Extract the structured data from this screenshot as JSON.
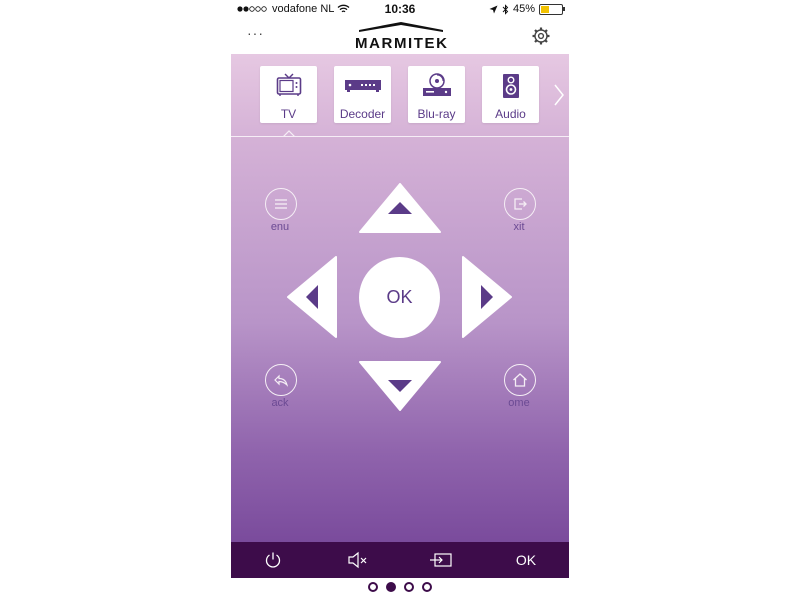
{
  "status_bar": {
    "carrier": "vodafone NL",
    "time": "10:36",
    "battery_percent_text": "45%",
    "battery_level": 0.45
  },
  "header": {
    "logo_text": "MARMITEK",
    "more_label": "···"
  },
  "devices": [
    {
      "label": "TV",
      "icon": "tv-icon",
      "selected": true
    },
    {
      "label": "Decoder",
      "icon": "decoder-icon",
      "selected": false
    },
    {
      "label": "Blu-ray",
      "icon": "bluray-icon",
      "selected": false
    },
    {
      "label": "Audio",
      "icon": "speaker-icon",
      "selected": false
    }
  ],
  "remote": {
    "menu_label": "enu",
    "exit_label": "xit",
    "back_label": "ack",
    "home_label": "ome",
    "ok_label": "OK"
  },
  "bottom_bar": {
    "ok_label": "OK"
  },
  "pages": {
    "count": 4,
    "active_index": 1
  },
  "colors": {
    "accent": "#5b3b88",
    "bottom_bar": "#3d0c4a",
    "gradient_top": "#e6c8e2",
    "gradient_bottom": "#7a4b9c"
  }
}
